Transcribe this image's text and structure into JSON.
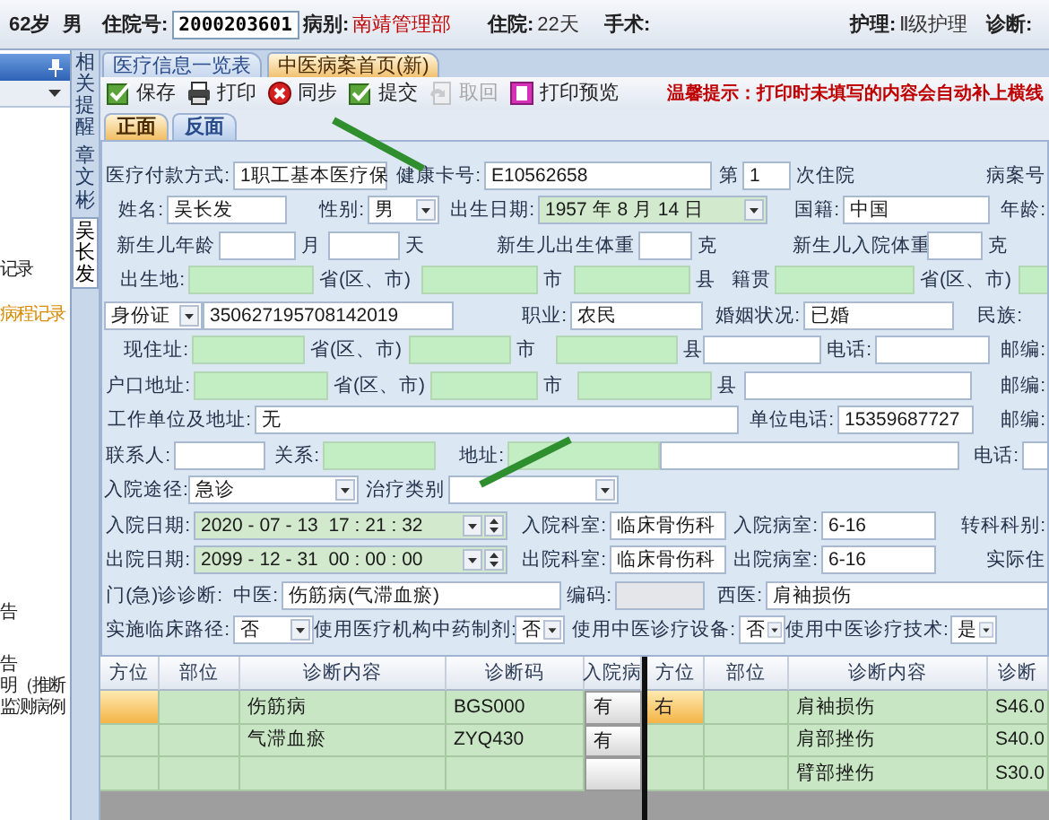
{
  "header": {
    "items": [
      {
        "text": "62岁"
      },
      {
        "text": "男"
      },
      {
        "label": "住院号:",
        "value": "2000203601",
        "kind": "box"
      },
      {
        "label": "病别:",
        "value": "南靖管理部",
        "kind": "alert"
      },
      {
        "label": "住院:",
        "value": "22天",
        "kind": "plain"
      },
      {
        "label": "手术:"
      },
      {
        "label": "护理:",
        "value": "Ⅱ级护理",
        "kind": "plain"
      },
      {
        "label": "诊断:"
      }
    ]
  },
  "side_panel": {
    "items": [
      {
        "text": "记录",
        "highlighted": false
      },
      {
        "text": "病程记录",
        "highlighted": true
      },
      {
        "text": "告",
        "highlighted": false
      },
      {
        "text": "告",
        "highlighted": false
      },
      {
        "text": "明（推断",
        "highlighted": false
      },
      {
        "text": "监测病例",
        "highlighted": false
      }
    ]
  },
  "vertical_tabs": [
    {
      "text": "相关提醒",
      "selected": false
    },
    {
      "text": "章文彬",
      "selected": false
    },
    {
      "text": "吴长发",
      "selected": true
    }
  ],
  "document_tabs": [
    {
      "text": "医疗信息一览表",
      "selected": false
    },
    {
      "text": "中医病案首页(新)",
      "selected": true
    }
  ],
  "toolbar": {
    "buttons": [
      {
        "text": "保存",
        "disabled": false
      },
      {
        "text": "打印",
        "disabled": false
      },
      {
        "text": "同步",
        "disabled": false
      },
      {
        "text": "提交",
        "disabled": false
      },
      {
        "text": "取回",
        "disabled": true
      },
      {
        "text": "打印预览",
        "disabled": false
      }
    ],
    "notice": "温馨提示：打印时未填写的内容会自动补上横线"
  },
  "page_tabs": [
    {
      "text": "正面",
      "selected": true
    },
    {
      "text": "反面",
      "selected": false
    }
  ],
  "form": {
    "rows": [
      {
        "items": [
          {
            "kind": "label",
            "text": "医疗付款方式:"
          },
          {
            "kind": "field",
            "text": "1职工基本医疗保"
          },
          {
            "kind": "label",
            "text": "健康卡号:"
          },
          {
            "kind": "field",
            "text": "E10562658"
          },
          {
            "kind": "label",
            "text": "第"
          },
          {
            "kind": "field",
            "text": "1"
          },
          {
            "kind": "unit",
            "text": "次住院"
          },
          {
            "kind": "label",
            "text": "病案号"
          }
        ]
      },
      {
        "items": [
          {
            "kind": "label",
            "text": "姓名:"
          },
          {
            "kind": "field",
            "text": "吴长发"
          },
          {
            "kind": "label",
            "text": "性别:"
          },
          {
            "kind": "select",
            "text": "男"
          },
          {
            "kind": "label",
            "text": "出生日期:"
          },
          {
            "kind": "date",
            "text": "1957 年 8 月 14 日"
          },
          {
            "kind": "label",
            "text": "国籍:"
          },
          {
            "kind": "field",
            "text": "中国"
          },
          {
            "kind": "label",
            "text": "年龄:"
          }
        ]
      },
      {
        "items": [
          {
            "kind": "label",
            "text": "新生儿年龄"
          },
          {
            "kind": "field"
          },
          {
            "kind": "unit",
            "text": "月"
          },
          {
            "kind": "field"
          },
          {
            "kind": "unit",
            "text": "天"
          },
          {
            "kind": "label",
            "text": "新生儿出生体重"
          },
          {
            "kind": "field"
          },
          {
            "kind": "unit",
            "text": "克"
          },
          {
            "kind": "label",
            "text": "新生儿入院体重"
          },
          {
            "kind": "field"
          },
          {
            "kind": "unit",
            "text": "克"
          }
        ]
      },
      {
        "items": [
          {
            "kind": "label",
            "text": "出生地:"
          },
          {
            "kind": "lookup"
          },
          {
            "kind": "unit",
            "text": "省(区、市)"
          },
          {
            "kind": "lookup"
          },
          {
            "kind": "unit",
            "text": "市"
          },
          {
            "kind": "lookup"
          },
          {
            "kind": "unit",
            "text": "县"
          },
          {
            "kind": "label",
            "text": "籍贯"
          },
          {
            "kind": "lookup"
          },
          {
            "kind": "unit",
            "text": "省(区、市)"
          },
          {
            "kind": "lookup"
          }
        ]
      },
      {
        "items": [
          {
            "kind": "select",
            "text": "身份证"
          },
          {
            "kind": "field",
            "text": "350627195708142019"
          },
          {
            "kind": "label",
            "text": "职业:"
          },
          {
            "kind": "field",
            "text": "农民"
          },
          {
            "kind": "label",
            "text": "婚姻状况:"
          },
          {
            "kind": "field",
            "text": "已婚"
          },
          {
            "kind": "label",
            "text": "民族:"
          }
        ]
      },
      {
        "items": [
          {
            "kind": "label",
            "text": "现住址:"
          },
          {
            "kind": "lookup"
          },
          {
            "kind": "unit",
            "text": "省(区、市)"
          },
          {
            "kind": "lookup"
          },
          {
            "kind": "unit",
            "text": "市"
          },
          {
            "kind": "lookup"
          },
          {
            "kind": "unit",
            "text": "县"
          },
          {
            "kind": "field"
          },
          {
            "kind": "label",
            "text": "电话:"
          },
          {
            "kind": "field"
          },
          {
            "kind": "label",
            "text": "邮编:"
          }
        ]
      },
      {
        "items": [
          {
            "kind": "label",
            "text": "户口地址:"
          },
          {
            "kind": "lookup"
          },
          {
            "kind": "unit",
            "text": "省(区、市)"
          },
          {
            "kind": "lookup"
          },
          {
            "kind": "unit",
            "text": "市"
          },
          {
            "kind": "lookup"
          },
          {
            "kind": "unit",
            "text": "县"
          },
          {
            "kind": "field"
          },
          {
            "kind": "label",
            "text": "邮编:"
          }
        ]
      },
      {
        "items": [
          {
            "kind": "label",
            "text": "工作单位及地址:"
          },
          {
            "kind": "field",
            "text": "无"
          },
          {
            "kind": "label",
            "text": "单位电话:"
          },
          {
            "kind": "field",
            "text": "15359687727"
          },
          {
            "kind": "label",
            "text": "邮编:"
          }
        ]
      },
      {
        "items": [
          {
            "kind": "label",
            "text": "联系人:"
          },
          {
            "kind": "field"
          },
          {
            "kind": "label",
            "text": "关系:"
          },
          {
            "kind": "lookup"
          },
          {
            "kind": "label",
            "text": "地址:"
          },
          {
            "kind": "lookup"
          },
          {
            "kind": "field"
          },
          {
            "kind": "label",
            "text": "电话:"
          },
          {
            "kind": "field"
          }
        ]
      },
      {
        "items": [
          {
            "kind": "label",
            "text": "入院途径:"
          },
          {
            "kind": "select",
            "text": "急诊"
          },
          {
            "kind": "label",
            "text": "治疗类别"
          },
          {
            "kind": "select"
          }
        ]
      },
      {
        "items": [
          {
            "kind": "label",
            "text": "入院日期:"
          },
          {
            "kind": "datetime",
            "text": "2020 - 07 - 13  17 : 21 : 32"
          },
          {
            "kind": "label",
            "text": "入院科室:"
          },
          {
            "kind": "field",
            "text": "临床骨伤科"
          },
          {
            "kind": "label",
            "text": "入院病室:"
          },
          {
            "kind": "field",
            "text": "6-16"
          },
          {
            "kind": "label",
            "text": "转科科别:"
          }
        ]
      },
      {
        "items": [
          {
            "kind": "label",
            "text": "出院日期:"
          },
          {
            "kind": "datetime",
            "text": "2099 - 12 - 31  00 : 00 : 00"
          },
          {
            "kind": "label",
            "text": "出院科室:"
          },
          {
            "kind": "field",
            "text": "临床骨伤科"
          },
          {
            "kind": "label",
            "text": "出院病室:"
          },
          {
            "kind": "field",
            "text": "6-16"
          },
          {
            "kind": "label",
            "text": "实际住"
          }
        ]
      },
      {
        "items": [
          {
            "kind": "label",
            "text": "门(急)诊诊断:"
          },
          {
            "kind": "label",
            "text": "中医:"
          },
          {
            "kind": "field",
            "text": "伤筋病(气滞血瘀)"
          },
          {
            "kind": "label",
            "text": "编码:"
          },
          {
            "kind": "readonly"
          },
          {
            "kind": "label",
            "text": "西医:"
          },
          {
            "kind": "field",
            "text": "肩袖损伤"
          }
        ]
      },
      {
        "items": [
          {
            "kind": "label",
            "text": "实施临床路径:"
          },
          {
            "kind": "select",
            "text": "否"
          },
          {
            "kind": "label",
            "text": "使用医疗机构中药制剂:"
          },
          {
            "kind": "select",
            "text": "否"
          },
          {
            "kind": "label",
            "text": "使用中医诊疗设备:"
          },
          {
            "kind": "select",
            "text": "否"
          },
          {
            "kind": "label",
            "text": "使用中医诊疗技术:"
          },
          {
            "kind": "select",
            "text": "是"
          }
        ]
      }
    ]
  },
  "diagnosis_tables": [
    {
      "columns": [
        {
          "text": "方位",
          "kind": "text"
        },
        {
          "text": "部位",
          "kind": "text"
        },
        {
          "text": "诊断内容",
          "kind": "text"
        },
        {
          "text": "诊断码",
          "kind": "text"
        },
        {
          "text": "入院病",
          "kind": "choice"
        }
      ],
      "rows": [
        {
          "cells": [
            "",
            "",
            "伤筋病",
            "BGS000",
            "有"
          ],
          "selected": true
        },
        {
          "cells": [
            "",
            "",
            "气滞血瘀",
            "ZYQ430",
            "有"
          ],
          "selected": false
        },
        {
          "cells": [
            "",
            "",
            "",
            "",
            ""
          ],
          "selected": false
        }
      ]
    },
    {
      "columns": [
        {
          "text": "方位",
          "kind": "text"
        },
        {
          "text": "部位",
          "kind": "text"
        },
        {
          "text": "诊断内容",
          "kind": "text"
        },
        {
          "text": "诊断",
          "kind": "text"
        }
      ],
      "rows": [
        {
          "cells": [
            "右",
            "",
            "肩袖损伤",
            "S46.0"
          ],
          "selected": true
        },
        {
          "cells": [
            "",
            "",
            "肩部挫伤",
            "S40.0"
          ],
          "selected": false
        },
        {
          "cells": [
            "",
            "",
            "臂部挫伤",
            "S30.0"
          ],
          "selected": false
        }
      ]
    }
  ]
}
